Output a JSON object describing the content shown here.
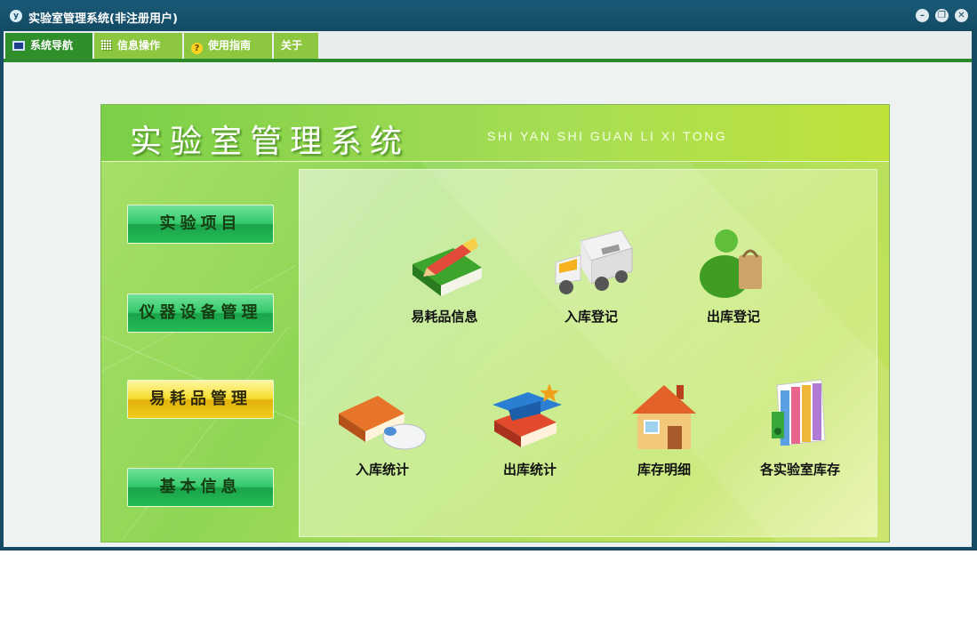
{
  "window": {
    "title": "实验室管理系统(非注册用户)"
  },
  "window_controls": {
    "minimize": "–",
    "restore": "❐",
    "close": "✕"
  },
  "menu": {
    "tabs": [
      {
        "label": "系统导航",
        "active": true
      },
      {
        "label": "信息操作",
        "active": false
      },
      {
        "label": "使用指南",
        "active": false
      },
      {
        "label": "关于",
        "active": false
      }
    ]
  },
  "panel": {
    "title": "实验室管理系统",
    "subtitle": "SHI YAN SHI GUAN LI XI TONG"
  },
  "nav_buttons": [
    {
      "label": "实验项目",
      "style": "green"
    },
    {
      "label": "仪器设备管理",
      "style": "green"
    },
    {
      "label": "易耗品管理",
      "style": "gold"
    },
    {
      "label": "基本信息",
      "style": "green"
    }
  ],
  "icons": [
    {
      "label": "易耗品信息",
      "icon": "book-pencil-icon"
    },
    {
      "label": "入库登记",
      "icon": "truck-icon"
    },
    {
      "label": "出库登记",
      "icon": "shopper-icon"
    },
    {
      "label": "入库统计",
      "icon": "book-mouse-icon"
    },
    {
      "label": "出库统计",
      "icon": "graduation-books-icon"
    },
    {
      "label": "库存明细",
      "icon": "house-icon"
    },
    {
      "label": "各实验室库存",
      "icon": "book-stack-icon"
    }
  ],
  "colors": {
    "titlebar": "#164b66",
    "menu_accent": "#2c8a2a",
    "active_tab": "#2f8f2a",
    "tab": "#8dc63f",
    "panel_green": "#8fd655",
    "gold_button": "#f6dd2f"
  }
}
